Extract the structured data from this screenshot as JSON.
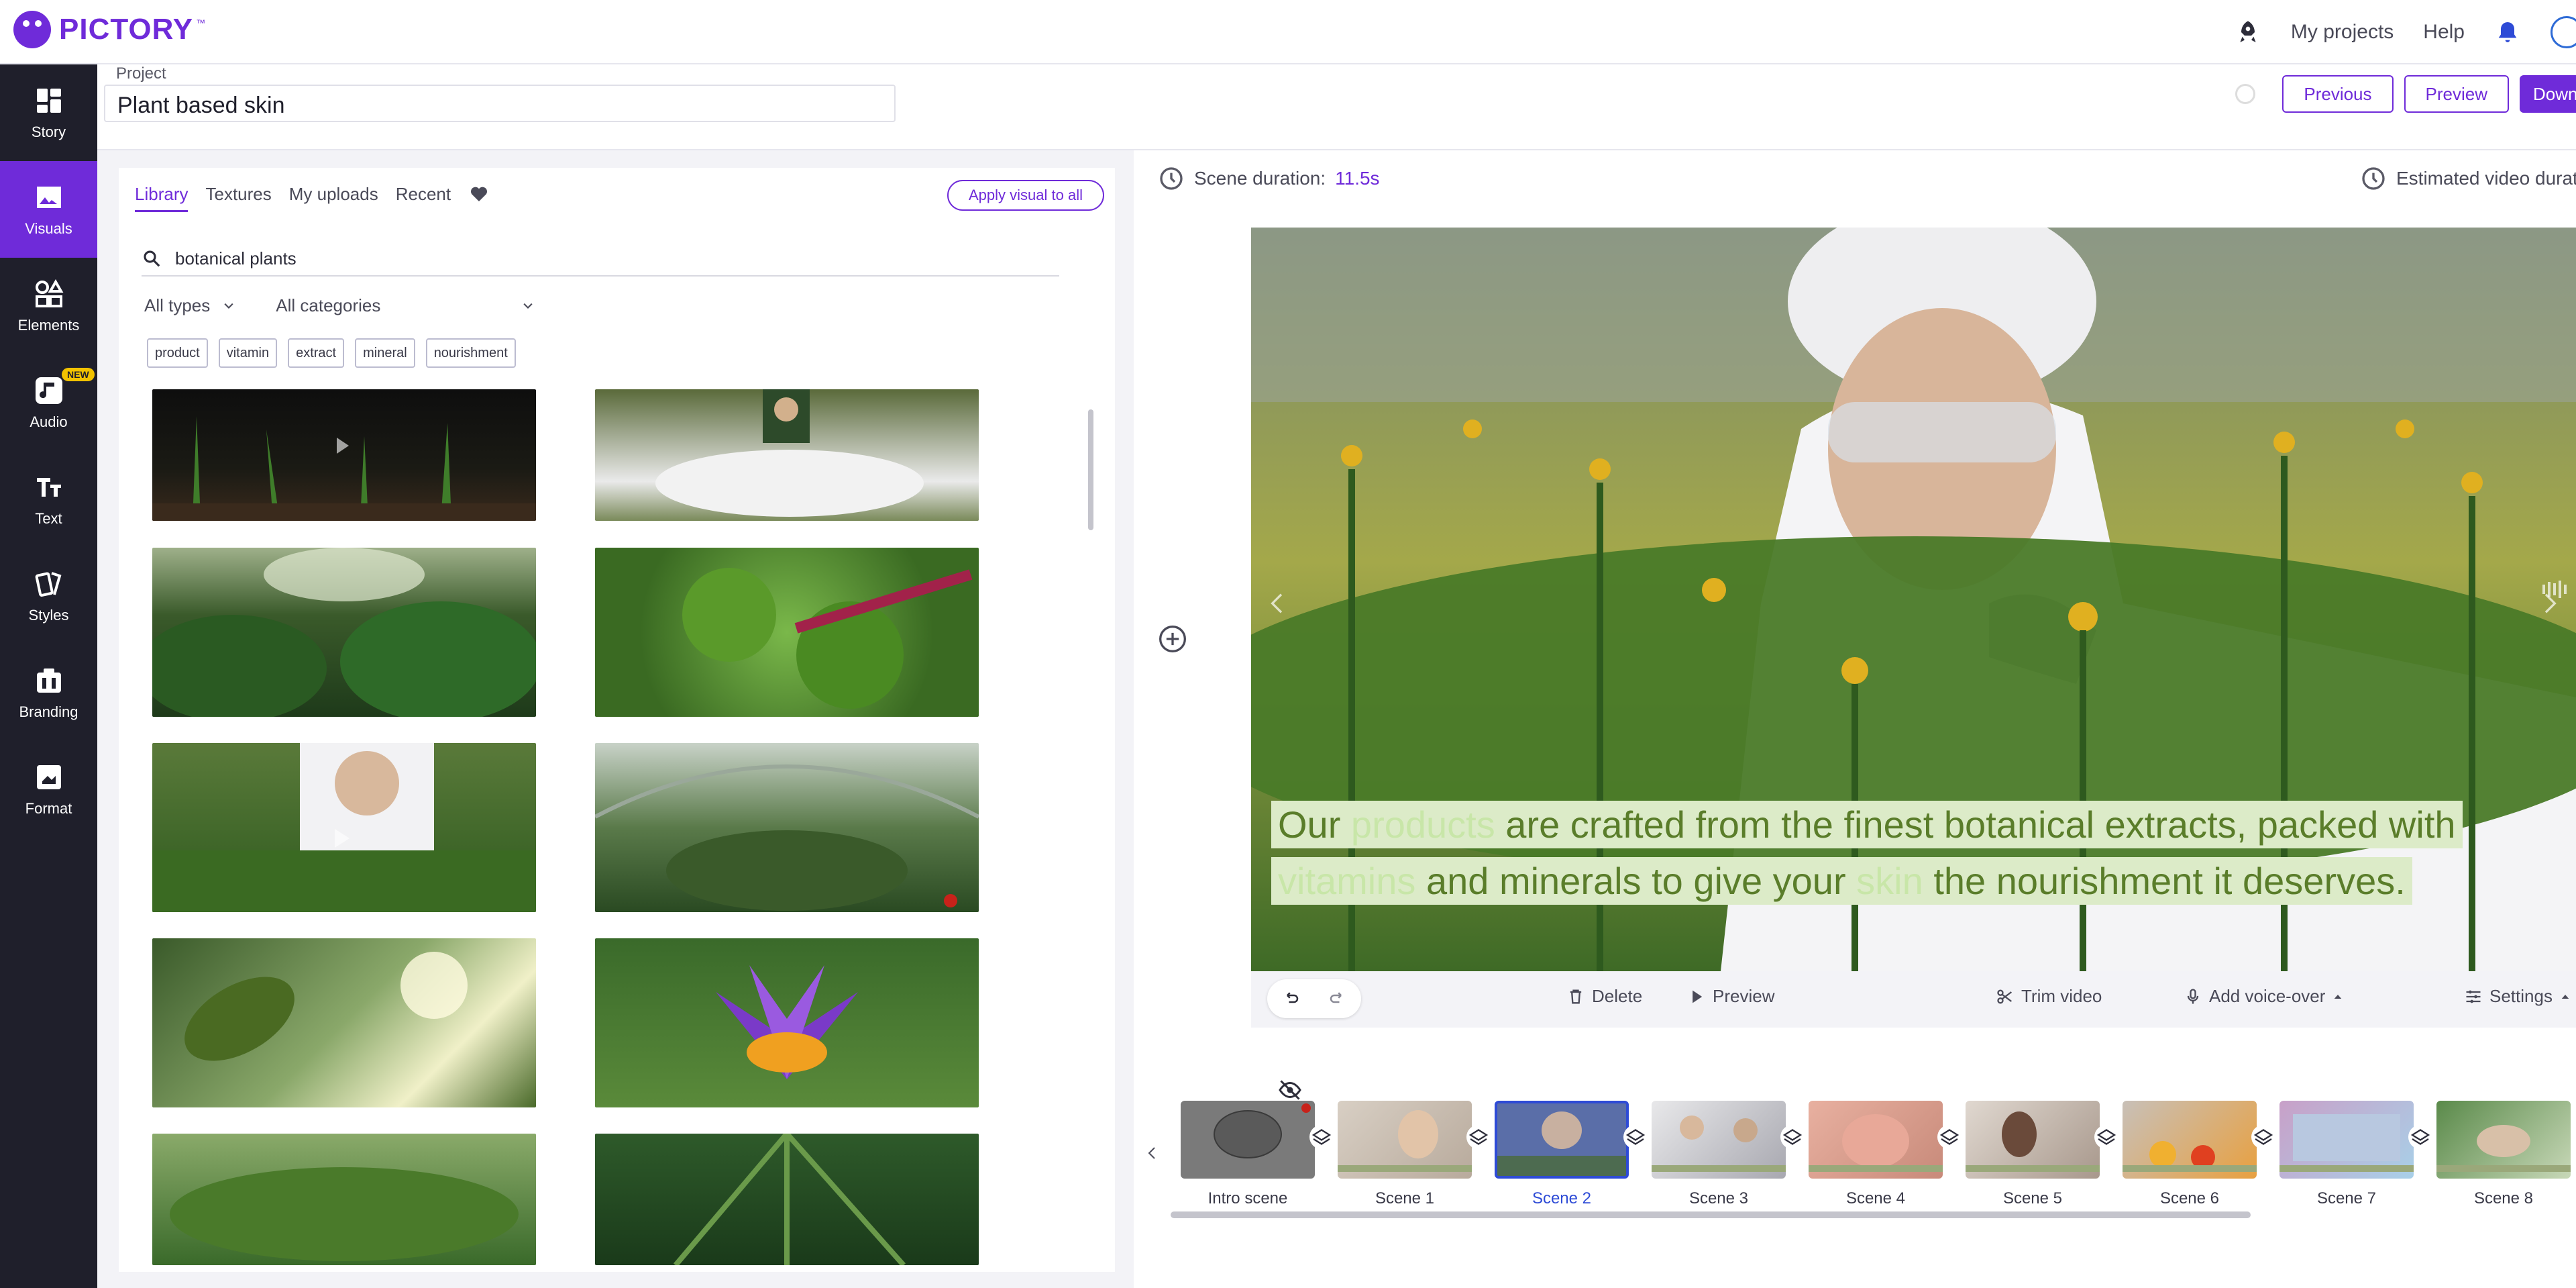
{
  "app": {
    "logo_text": "PICTORY",
    "logo_tm": "™"
  },
  "topnav": {
    "my_projects": "My projects",
    "help": "Help"
  },
  "sidebar": {
    "items": [
      {
        "label": "Story",
        "icon": "story-icon"
      },
      {
        "label": "Visuals",
        "icon": "visuals-icon",
        "active": true
      },
      {
        "label": "Elements",
        "icon": "elements-icon"
      },
      {
        "label": "Audio",
        "icon": "audio-icon",
        "badge": "NEW"
      },
      {
        "label": "Text",
        "icon": "text-icon"
      },
      {
        "label": "Styles",
        "icon": "styles-icon"
      },
      {
        "label": "Branding",
        "icon": "branding-icon"
      },
      {
        "label": "Format",
        "icon": "format-icon"
      }
    ]
  },
  "project": {
    "label": "Project",
    "name": "Plant based skin"
  },
  "header_actions": {
    "previous": "Previous",
    "preview": "Preview",
    "download": "Down"
  },
  "library": {
    "tabs": [
      "Library",
      "Textures",
      "My uploads",
      "Recent"
    ],
    "apply_all": "Apply visual to all",
    "search_value": "botanical plants",
    "filter_types": "All types",
    "filter_categories": "All categories",
    "chips": [
      "product",
      "vitamin",
      "extract",
      "mineral",
      "nourishment"
    ]
  },
  "editor": {
    "scene_duration_label": "Scene duration:",
    "scene_duration_value": "11.5s",
    "estimated_label": "Estimated video durati",
    "caption_parts": [
      {
        "t": "Our ",
        "kw": false
      },
      {
        "t": "products",
        "kw": true
      },
      {
        "t": " are crafted from the finest botanical extracts, packed with ",
        "kw": false
      },
      {
        "t": "vitamins",
        "kw": true
      },
      {
        "t": " and minerals to give your ",
        "kw": false
      },
      {
        "t": "skin",
        "kw": true
      },
      {
        "t": " the nourishment it deserves.",
        "kw": false
      }
    ],
    "toolbar": {
      "delete": "Delete",
      "preview": "Preview",
      "trim": "Trim video",
      "voiceover": "Add voice-over",
      "settings": "Settings"
    }
  },
  "timeline": {
    "scenes": [
      "Intro scene",
      "Scene 1",
      "Scene 2",
      "Scene 3",
      "Scene 4",
      "Scene 5",
      "Scene 6",
      "Scene 7",
      "Scene 8"
    ],
    "active_index": 2
  },
  "colors": {
    "brand": "#6f2bd9",
    "sidebar": "#1f1f2b",
    "active_scene": "#2e4bd6"
  }
}
